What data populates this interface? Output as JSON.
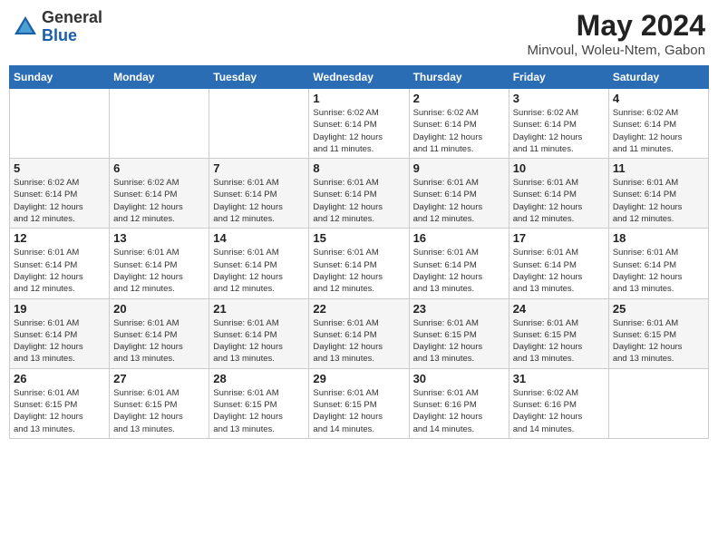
{
  "header": {
    "logo": {
      "general": "General",
      "blue": "Blue"
    },
    "month": "May 2024",
    "location": "Minvoul, Woleu-Ntem, Gabon"
  },
  "weekdays": [
    "Sunday",
    "Monday",
    "Tuesday",
    "Wednesday",
    "Thursday",
    "Friday",
    "Saturday"
  ],
  "weeks": [
    [
      {
        "day": "",
        "info": ""
      },
      {
        "day": "",
        "info": ""
      },
      {
        "day": "",
        "info": ""
      },
      {
        "day": "1",
        "info": "Sunrise: 6:02 AM\nSunset: 6:14 PM\nDaylight: 12 hours\nand 11 minutes."
      },
      {
        "day": "2",
        "info": "Sunrise: 6:02 AM\nSunset: 6:14 PM\nDaylight: 12 hours\nand 11 minutes."
      },
      {
        "day": "3",
        "info": "Sunrise: 6:02 AM\nSunset: 6:14 PM\nDaylight: 12 hours\nand 11 minutes."
      },
      {
        "day": "4",
        "info": "Sunrise: 6:02 AM\nSunset: 6:14 PM\nDaylight: 12 hours\nand 11 minutes."
      }
    ],
    [
      {
        "day": "5",
        "info": "Sunrise: 6:02 AM\nSunset: 6:14 PM\nDaylight: 12 hours\nand 12 minutes."
      },
      {
        "day": "6",
        "info": "Sunrise: 6:02 AM\nSunset: 6:14 PM\nDaylight: 12 hours\nand 12 minutes."
      },
      {
        "day": "7",
        "info": "Sunrise: 6:01 AM\nSunset: 6:14 PM\nDaylight: 12 hours\nand 12 minutes."
      },
      {
        "day": "8",
        "info": "Sunrise: 6:01 AM\nSunset: 6:14 PM\nDaylight: 12 hours\nand 12 minutes."
      },
      {
        "day": "9",
        "info": "Sunrise: 6:01 AM\nSunset: 6:14 PM\nDaylight: 12 hours\nand 12 minutes."
      },
      {
        "day": "10",
        "info": "Sunrise: 6:01 AM\nSunset: 6:14 PM\nDaylight: 12 hours\nand 12 minutes."
      },
      {
        "day": "11",
        "info": "Sunrise: 6:01 AM\nSunset: 6:14 PM\nDaylight: 12 hours\nand 12 minutes."
      }
    ],
    [
      {
        "day": "12",
        "info": "Sunrise: 6:01 AM\nSunset: 6:14 PM\nDaylight: 12 hours\nand 12 minutes."
      },
      {
        "day": "13",
        "info": "Sunrise: 6:01 AM\nSunset: 6:14 PM\nDaylight: 12 hours\nand 12 minutes."
      },
      {
        "day": "14",
        "info": "Sunrise: 6:01 AM\nSunset: 6:14 PM\nDaylight: 12 hours\nand 12 minutes."
      },
      {
        "day": "15",
        "info": "Sunrise: 6:01 AM\nSunset: 6:14 PM\nDaylight: 12 hours\nand 12 minutes."
      },
      {
        "day": "16",
        "info": "Sunrise: 6:01 AM\nSunset: 6:14 PM\nDaylight: 12 hours\nand 13 minutes."
      },
      {
        "day": "17",
        "info": "Sunrise: 6:01 AM\nSunset: 6:14 PM\nDaylight: 12 hours\nand 13 minutes."
      },
      {
        "day": "18",
        "info": "Sunrise: 6:01 AM\nSunset: 6:14 PM\nDaylight: 12 hours\nand 13 minutes."
      }
    ],
    [
      {
        "day": "19",
        "info": "Sunrise: 6:01 AM\nSunset: 6:14 PM\nDaylight: 12 hours\nand 13 minutes."
      },
      {
        "day": "20",
        "info": "Sunrise: 6:01 AM\nSunset: 6:14 PM\nDaylight: 12 hours\nand 13 minutes."
      },
      {
        "day": "21",
        "info": "Sunrise: 6:01 AM\nSunset: 6:14 PM\nDaylight: 12 hours\nand 13 minutes."
      },
      {
        "day": "22",
        "info": "Sunrise: 6:01 AM\nSunset: 6:14 PM\nDaylight: 12 hours\nand 13 minutes."
      },
      {
        "day": "23",
        "info": "Sunrise: 6:01 AM\nSunset: 6:15 PM\nDaylight: 12 hours\nand 13 minutes."
      },
      {
        "day": "24",
        "info": "Sunrise: 6:01 AM\nSunset: 6:15 PM\nDaylight: 12 hours\nand 13 minutes."
      },
      {
        "day": "25",
        "info": "Sunrise: 6:01 AM\nSunset: 6:15 PM\nDaylight: 12 hours\nand 13 minutes."
      }
    ],
    [
      {
        "day": "26",
        "info": "Sunrise: 6:01 AM\nSunset: 6:15 PM\nDaylight: 12 hours\nand 13 minutes."
      },
      {
        "day": "27",
        "info": "Sunrise: 6:01 AM\nSunset: 6:15 PM\nDaylight: 12 hours\nand 13 minutes."
      },
      {
        "day": "28",
        "info": "Sunrise: 6:01 AM\nSunset: 6:15 PM\nDaylight: 12 hours\nand 13 minutes."
      },
      {
        "day": "29",
        "info": "Sunrise: 6:01 AM\nSunset: 6:15 PM\nDaylight: 12 hours\nand 14 minutes."
      },
      {
        "day": "30",
        "info": "Sunrise: 6:01 AM\nSunset: 6:16 PM\nDaylight: 12 hours\nand 14 minutes."
      },
      {
        "day": "31",
        "info": "Sunrise: 6:02 AM\nSunset: 6:16 PM\nDaylight: 12 hours\nand 14 minutes."
      },
      {
        "day": "",
        "info": ""
      }
    ]
  ]
}
